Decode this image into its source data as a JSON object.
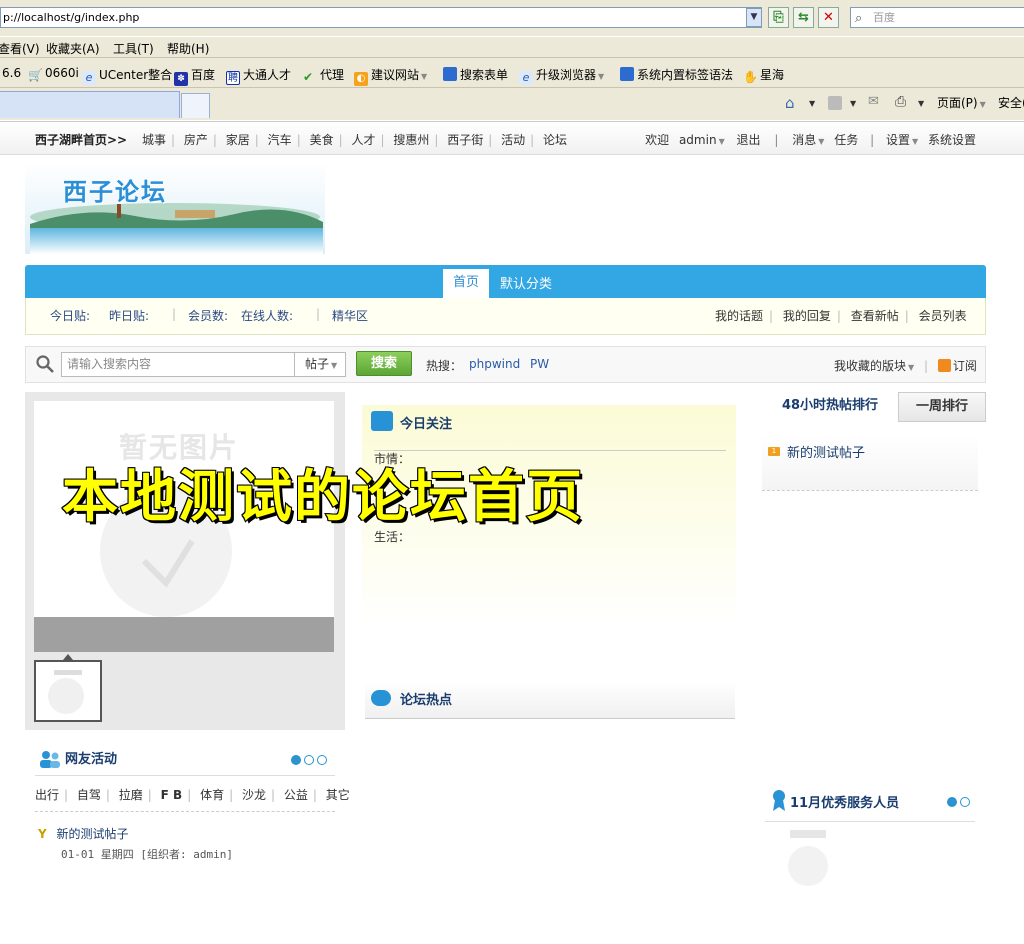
{
  "browser": {
    "address": "p://localhost/g/index.php",
    "web_search_placeholder": "百度",
    "menu": [
      "查看(V)",
      "收藏夹(A)",
      "工具(T)",
      "帮助(H)"
    ],
    "favorites": [
      "6.6",
      "0660i",
      "UCenter整合",
      "百度",
      "大通人才",
      "代理",
      "建议网站",
      "搜索表单",
      "升级浏览器",
      "系统内置标签语法",
      "星海"
    ],
    "tools": [
      "页面(P)",
      "安全("
    ]
  },
  "topbar": {
    "site_home": "西子湖畔首页>>",
    "links": [
      "城事",
      "房产",
      "家居",
      "汽车",
      "美食",
      "人才",
      "搜惠州",
      "西子街",
      "活动",
      "论坛"
    ],
    "welcome": "欢迎",
    "username": "admin",
    "logout": "退出",
    "messages": "消息",
    "tasks": "任务",
    "settings": "设置",
    "system_settings": "系统设置"
  },
  "logo": {
    "text": "西子论坛"
  },
  "nav": {
    "tabs": [
      "首页",
      "默认分类"
    ]
  },
  "stats": {
    "today": "今日贴:",
    "yesterday": "昨日贴:",
    "members": "会员数:",
    "online": "在线人数:",
    "digest": "精华区",
    "right_links": [
      "我的话题",
      "我的回复",
      "查看新帖",
      "会员列表"
    ]
  },
  "search": {
    "placeholder": "请输入搜索内容",
    "scope": "帖子",
    "button": "搜索",
    "hot_label": "热搜：",
    "hot_terms": [
      "phpwind",
      "PW"
    ],
    "fav_blocks": "我收藏的版块",
    "subscribe": "订阅"
  },
  "slider": {
    "watermark": "暂无图片"
  },
  "today_focus": {
    "title": "今日关注",
    "rows": [
      "市情：",
      "生活："
    ]
  },
  "forum_hot": {
    "title": "论坛热点"
  },
  "rank": {
    "tab_active": "48小时热帖排行",
    "tab_inactive": "一周排行",
    "items": [
      {
        "num": "1",
        "title": "新的测试帖子"
      }
    ]
  },
  "activity": {
    "title": "网友活动",
    "categories": [
      "出行",
      "自驾",
      "拉磨",
      "F B",
      "体育",
      "沙龙",
      "公益",
      "其它"
    ],
    "post_title": "新的测试帖子",
    "post_meta": "01-01 星期四 [组织者: admin]"
  },
  "staff": {
    "title": "11月优秀服务人员"
  },
  "overlay_caption": "本地测试的论坛首页",
  "colors": {
    "accent_blue": "#33a7e3",
    "search_green": "#5ba636",
    "caption_yellow": "#ffff00"
  }
}
